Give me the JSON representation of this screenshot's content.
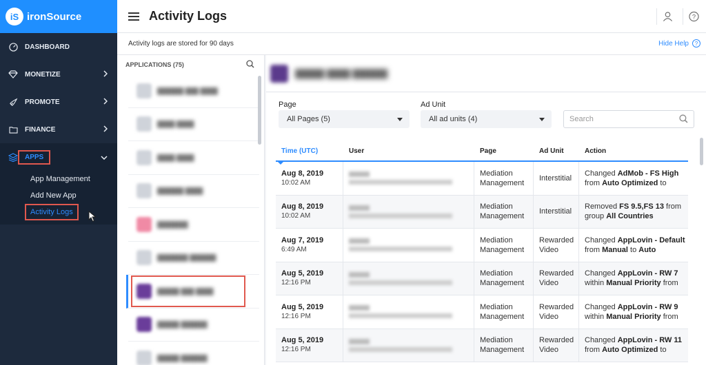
{
  "brand": {
    "logo_letter": "iS",
    "name": "ironSource"
  },
  "sidebar": {
    "items": [
      {
        "label": "DASHBOARD",
        "icon": "speedometer-icon"
      },
      {
        "label": "MONETIZE",
        "icon": "diamond-icon"
      },
      {
        "label": "PROMOTE",
        "icon": "rocket-icon"
      },
      {
        "label": "FINANCE",
        "icon": "folder-icon"
      },
      {
        "label": "APPS",
        "icon": "layers-icon"
      }
    ],
    "apps_sub": [
      "App Management",
      "Add New App",
      "Activity Logs"
    ]
  },
  "header": {
    "title": "Activity Logs"
  },
  "info": {
    "text": "Activity logs are stored for 90 days",
    "hide_help": "Hide Help"
  },
  "applications": {
    "heading": "APPLICATIONS (75)"
  },
  "filters": {
    "page_label": "Page",
    "page_value": "All Pages (5)",
    "adunit_label": "Ad Unit",
    "adunit_value": "All ad units (4)",
    "search_placeholder": "Search"
  },
  "table": {
    "headers": [
      "Time (UTC)",
      "User",
      "Page",
      "Ad Unit",
      "Action"
    ],
    "rows": [
      {
        "date": "Aug 8, 2019",
        "time": "10:02 AM",
        "page1": "Mediation",
        "page2": "Management",
        "unit1": "Interstitial",
        "unit2": "",
        "a1": "Changed ",
        "a1b": "AdMob - FS High",
        "a2": "from ",
        "a2b": "Auto Optimized",
        "a2c": " to"
      },
      {
        "date": "Aug 8, 2019",
        "time": "10:02 AM",
        "page1": "Mediation",
        "page2": "Management",
        "unit1": "Interstitial",
        "unit2": "",
        "a1": "Removed ",
        "a1b": "FS 9.5,FS 13",
        "a1c": " from",
        "a2": "group ",
        "a2b": "All Countries",
        "a2c": ""
      },
      {
        "date": "Aug 7, 2019",
        "time": "6:49 AM",
        "page1": "Mediation",
        "page2": "Management",
        "unit1": "Rewarded",
        "unit2": "Video",
        "a1": "Changed ",
        "a1b": "AppLovin - Default",
        "a2": "from ",
        "a2b": "Manual",
        "a2c": " to ",
        "a2d": "Auto"
      },
      {
        "date": "Aug 5, 2019",
        "time": "12:16 PM",
        "page1": "Mediation",
        "page2": "Management",
        "unit1": "Rewarded",
        "unit2": "Video",
        "a1": "Changed ",
        "a1b": "AppLovin - RW 7",
        "a2": "within ",
        "a2b": "Manual Priority",
        "a2c": " from"
      },
      {
        "date": "Aug 5, 2019",
        "time": "12:16 PM",
        "page1": "Mediation",
        "page2": "Management",
        "unit1": "Rewarded",
        "unit2": "Video",
        "a1": "Changed ",
        "a1b": "AppLovin - RW 9",
        "a2": "within ",
        "a2b": "Manual Priority",
        "a2c": " from"
      },
      {
        "date": "Aug 5, 2019",
        "time": "12:16 PM",
        "page1": "Mediation",
        "page2": "Management",
        "unit1": "Rewarded",
        "unit2": "Video",
        "a1": "Changed ",
        "a1b": "AppLovin - RW 11",
        "a2": "from ",
        "a2b": "Auto Optimized",
        "a2c": " to"
      }
    ]
  },
  "colors": {
    "accent": "#2e8cff",
    "sidebar": "#1d2a3d",
    "highlight": "#e0584e"
  }
}
